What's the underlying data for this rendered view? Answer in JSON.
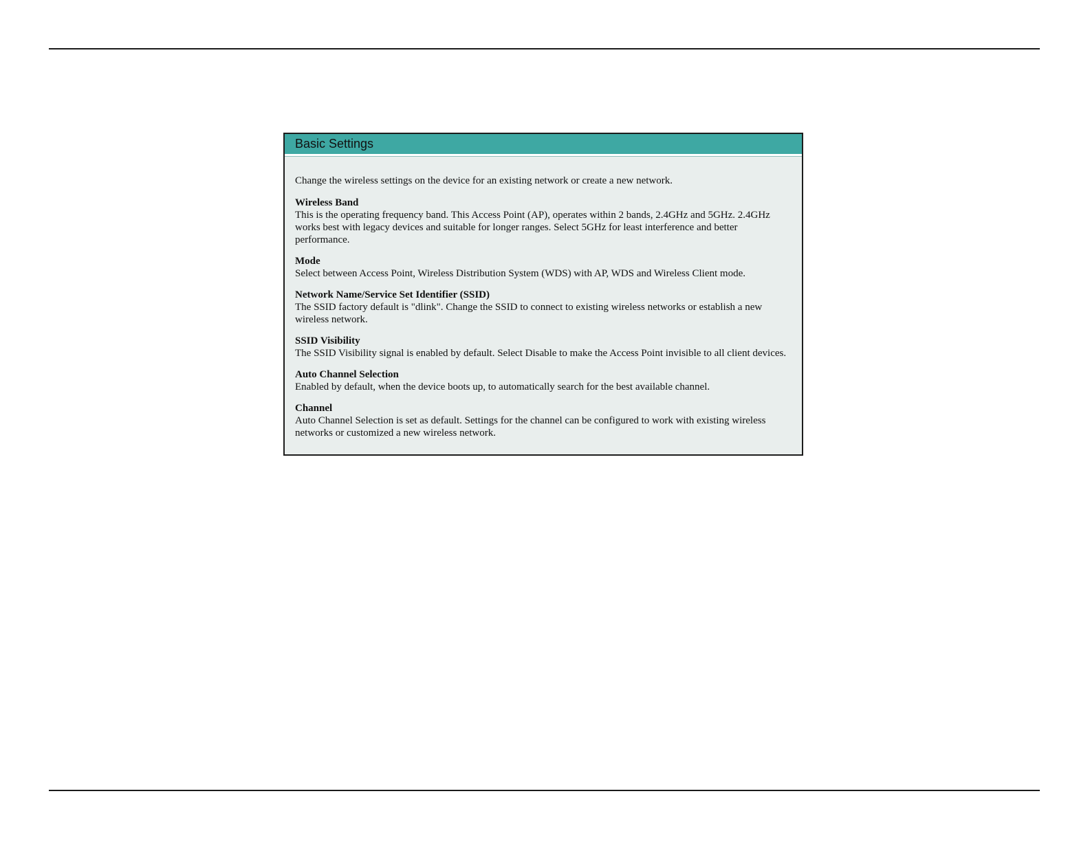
{
  "panel": {
    "title": "Basic Settings",
    "intro": "Change the wireless settings on the device for an existing network or create a new network.",
    "sections": [
      {
        "heading": "Wireless Band",
        "text": "This is the operating frequency band. This Access Point (AP), operates within 2 bands, 2.4GHz and 5GHz. 2.4GHz works best with legacy devices and suitable for longer ranges. Select 5GHz for least interference and better performance."
      },
      {
        "heading": "Mode",
        "text": "Select between Access Point, Wireless Distribution System (WDS) with AP, WDS and Wireless Client mode."
      },
      {
        "heading": "Network Name/Service Set Identifier (SSID)",
        "text": "The SSID factory default is \"dlink\". Change the SSID to connect to existing wireless networks or establish a new wireless network."
      },
      {
        "heading": "SSID Visibility",
        "text": "The SSID Visibility signal is enabled by default. Select Disable to make the Access Point invisible to all client devices."
      },
      {
        "heading": "Auto Channel Selection",
        "text": "Enabled by default, when the device boots up, to automatically search for the best available channel."
      },
      {
        "heading": "Channel",
        "text": "Auto Channel Selection is set as default. Settings for the channel can be configured to work with existing wireless networks or customized a new wireless network."
      }
    ]
  },
  "colors": {
    "header_bg": "#3ea8a3",
    "panel_bg": "#e9eeed",
    "border": "#1c1c1c"
  }
}
